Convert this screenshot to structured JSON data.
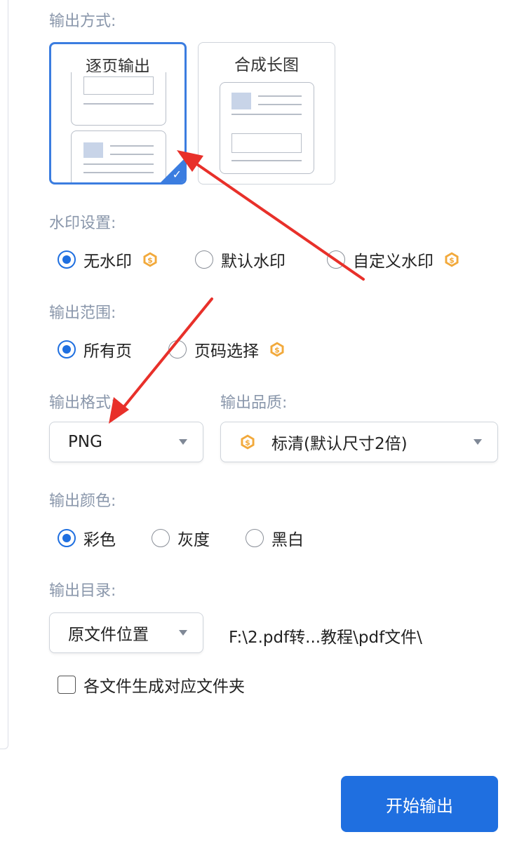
{
  "output_mode": {
    "label": "输出方式:",
    "options": [
      {
        "label": "逐页输出",
        "selected": true
      },
      {
        "label": "合成长图",
        "selected": false
      }
    ]
  },
  "watermark": {
    "label": "水印设置:",
    "options": [
      {
        "label": "无水印",
        "checked": true,
        "vip": true
      },
      {
        "label": "默认水印",
        "checked": false,
        "vip": false
      },
      {
        "label": "自定义水印",
        "checked": false,
        "vip": true
      }
    ]
  },
  "range": {
    "label": "输出范围:",
    "options": [
      {
        "label": "所有页",
        "checked": true,
        "vip": false
      },
      {
        "label": "页码选择",
        "checked": false,
        "vip": true
      }
    ]
  },
  "format": {
    "label": "输出格式:",
    "value": "PNG"
  },
  "quality": {
    "label": "输出品质:",
    "value": "标清(默认尺寸2倍)",
    "vip": true
  },
  "color": {
    "label": "输出颜色:",
    "options": [
      {
        "label": "彩色",
        "checked": true
      },
      {
        "label": "灰度",
        "checked": false
      },
      {
        "label": "黑白",
        "checked": false
      }
    ]
  },
  "directory": {
    "label": "输出目录:",
    "select_value": "原文件位置",
    "path": "F:\\2.pdf转...教程\\pdf文件\\",
    "folder_checkbox_label": "各文件生成对应文件夹",
    "folder_checkbox_checked": false
  },
  "start_button_label": "开始输出",
  "colors": {
    "accent": "#1f6fe0",
    "label": "#8a97ab",
    "vip": "#f2a93b",
    "annotation_arrow": "#e8302a"
  }
}
